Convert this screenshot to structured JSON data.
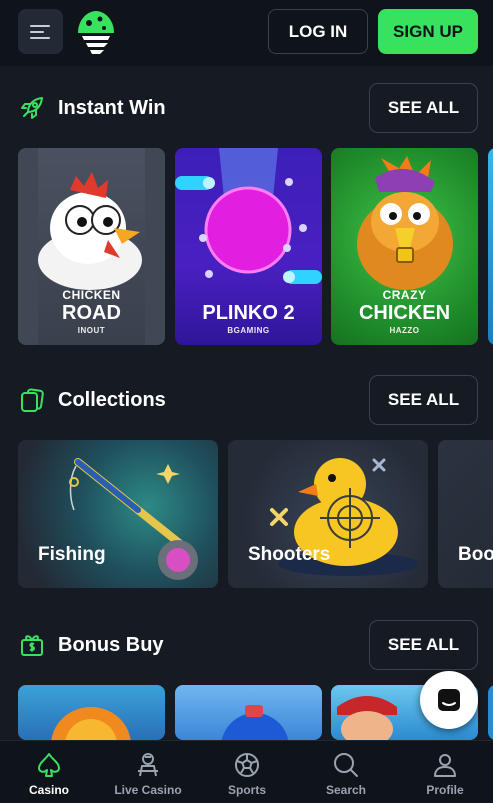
{
  "header": {
    "login_label": "LOG IN",
    "signup_label": "SIGN UP",
    "accent": "#39e25e"
  },
  "sections": {
    "instant_win": {
      "title": "Instant Win",
      "see_all": "SEE ALL",
      "games": [
        {
          "line1": "CHICKEN",
          "line2": "ROAD",
          "provider": "INOUT"
        },
        {
          "line1": "",
          "line2": "PLINKO 2",
          "provider": "BGAMING"
        },
        {
          "line1": "CRAZY",
          "line2": "CHICKEN",
          "provider": "HAZZO"
        }
      ]
    },
    "collections": {
      "title": "Collections",
      "see_all": "SEE ALL",
      "items": [
        "Fishing",
        "Shooters",
        "Boo"
      ]
    },
    "bonus_buy": {
      "title": "Bonus Buy",
      "see_all": "SEE ALL"
    }
  },
  "tabbar": {
    "tabs": [
      {
        "label": "Casino",
        "icon": "spade-icon"
      },
      {
        "label": "Live Casino",
        "icon": "dealer-icon"
      },
      {
        "label": "Sports",
        "icon": "soccer-ball-icon"
      },
      {
        "label": "Search",
        "icon": "search-icon"
      },
      {
        "label": "Profile",
        "icon": "user-icon"
      }
    ],
    "active": "Casino"
  }
}
